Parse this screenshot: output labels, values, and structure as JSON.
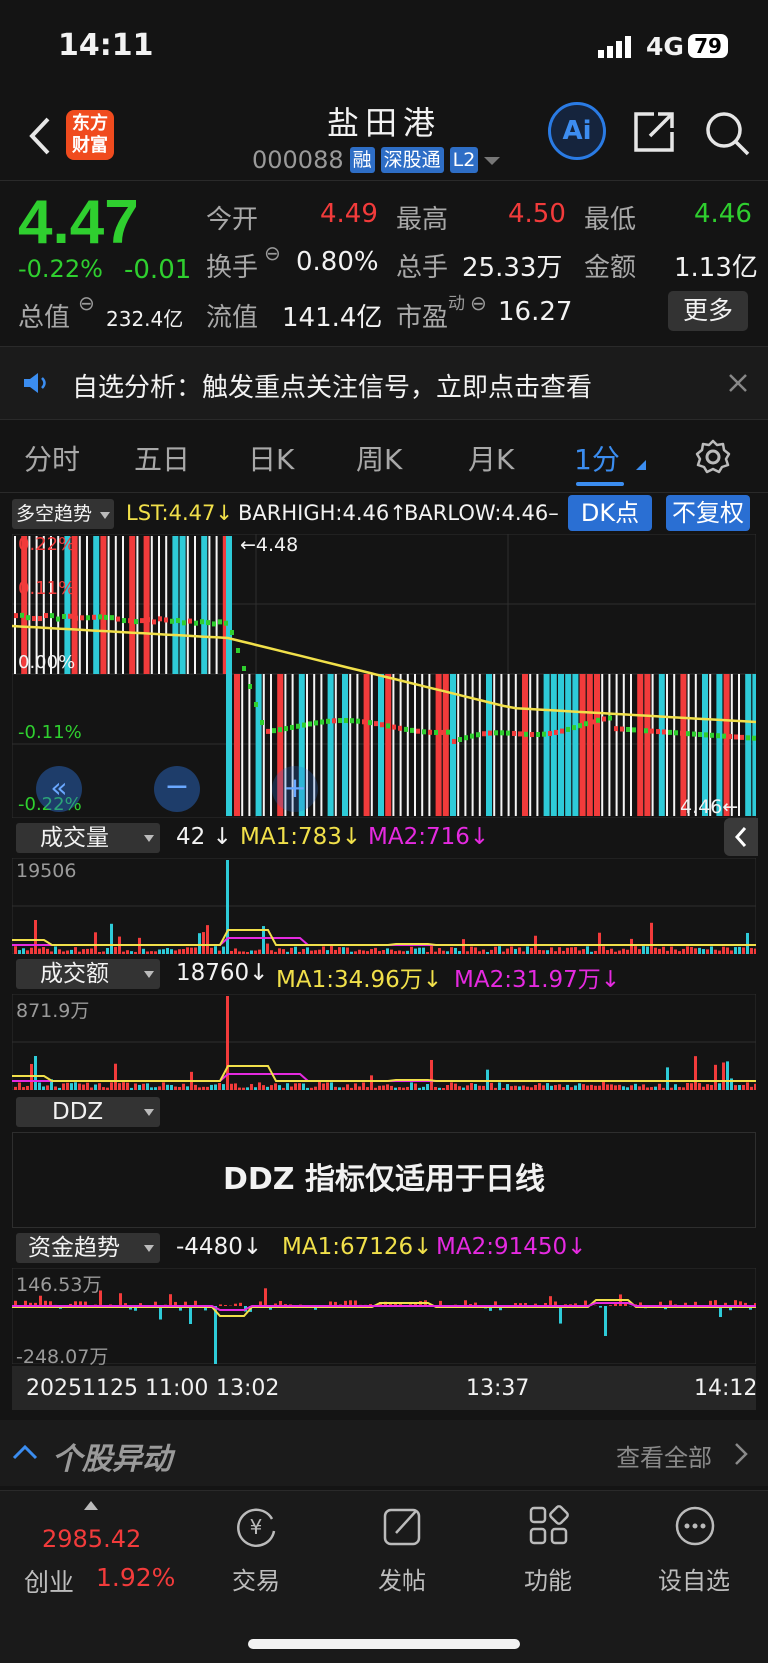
{
  "status": {
    "time": "14:11",
    "network": "4G",
    "battery": "79"
  },
  "header": {
    "logo_line1": "东方",
    "logo_line2": "财富",
    "title": "盐田港",
    "code": "000088",
    "badges": [
      "融",
      "深股通",
      "L2"
    ],
    "ai_label": "Ai"
  },
  "quote": {
    "price": "4.47",
    "change_pct": "-0.22%",
    "change": "-0.01",
    "rows": [
      [
        {
          "label": "今开",
          "value": "4.49",
          "color": "#f23b3b"
        },
        {
          "label": "最高",
          "value": "4.50",
          "color": "#f23b3b"
        },
        {
          "label": "最低",
          "value": "4.46",
          "color": "#2fcf2f"
        }
      ],
      [
        {
          "label": "换手",
          "value": "0.80%",
          "color": "#f2f2f2"
        },
        {
          "label": "总手",
          "value": "25.33万",
          "color": "#f2f2f2"
        },
        {
          "label": "金额",
          "value": "1.13亿",
          "color": "#f2f2f2"
        }
      ],
      [
        {
          "label": "总值",
          "value": "232.4亿",
          "color": "#f2f2f2"
        },
        {
          "label": "流值",
          "value": "141.4亿",
          "color": "#f2f2f2"
        },
        {
          "label": "市盈",
          "value": "16.27",
          "color": "#f2f2f2"
        }
      ]
    ],
    "pe_sup": "动",
    "more_button": "更多"
  },
  "notice": {
    "text": "自选分析：触发重点关注信号，立即点击查看"
  },
  "tabs": [
    "分时",
    "五日",
    "日K",
    "周K",
    "月K",
    "1分"
  ],
  "active_tab": "1分",
  "indicator_bar": {
    "selector": "多空趋势",
    "lst": "LST:4.47",
    "barhigh": "BARHIGH:4.46",
    "barlow": "BARLOW:4.46",
    "dk_button": "DK点",
    "fq_button": "不复权"
  },
  "chart_data": {
    "type": "bar",
    "main": {
      "ylabels_left": [
        "0.22%",
        "0.11%",
        "0.00%",
        "-0.11%",
        "-0.22%"
      ],
      "high_label": "←4.48",
      "low_label": "4.46←",
      "price_high": 4.48,
      "price_low": 4.46,
      "base": 4.47
    },
    "volume": {
      "selector": "成交量",
      "value": "42",
      "ma1": "MA1:783",
      "ma2": "MA2:716",
      "ymax_label": "19506"
    },
    "amount": {
      "selector": "成交额",
      "value": "18760",
      "ma1": "MA1:34.96万",
      "ma2": "MA2:31.97万",
      "ymax_label": "871.9万"
    },
    "ddz": {
      "selector": "DDZ",
      "message": "DDZ 指标仅适用于日线"
    },
    "fund": {
      "selector": "资金趋势",
      "value": "-4480",
      "ma1": "MA1:67126",
      "ma2": "MA2:91450",
      "ymax_label": "146.53万",
      "ymin_label": "-248.07万"
    },
    "x_labels": [
      "20251125 11:00",
      "13:02",
      "13:37",
      "14:12"
    ]
  },
  "movement": {
    "title": "个股异动",
    "link": "查看全部"
  },
  "bottom_nav": {
    "index_value": "2985.42",
    "index_name": "创业",
    "index_pct": "1.92%",
    "items": [
      "交易",
      "发帖",
      "功能",
      "设自选"
    ]
  },
  "colors": {
    "up": "#f23b3b",
    "down": "#2fcf2f",
    "cyan": "#2ecbd8",
    "accent": "#2a6fd3",
    "yellow": "#f1e04a",
    "magenta": "#e52ae0"
  }
}
